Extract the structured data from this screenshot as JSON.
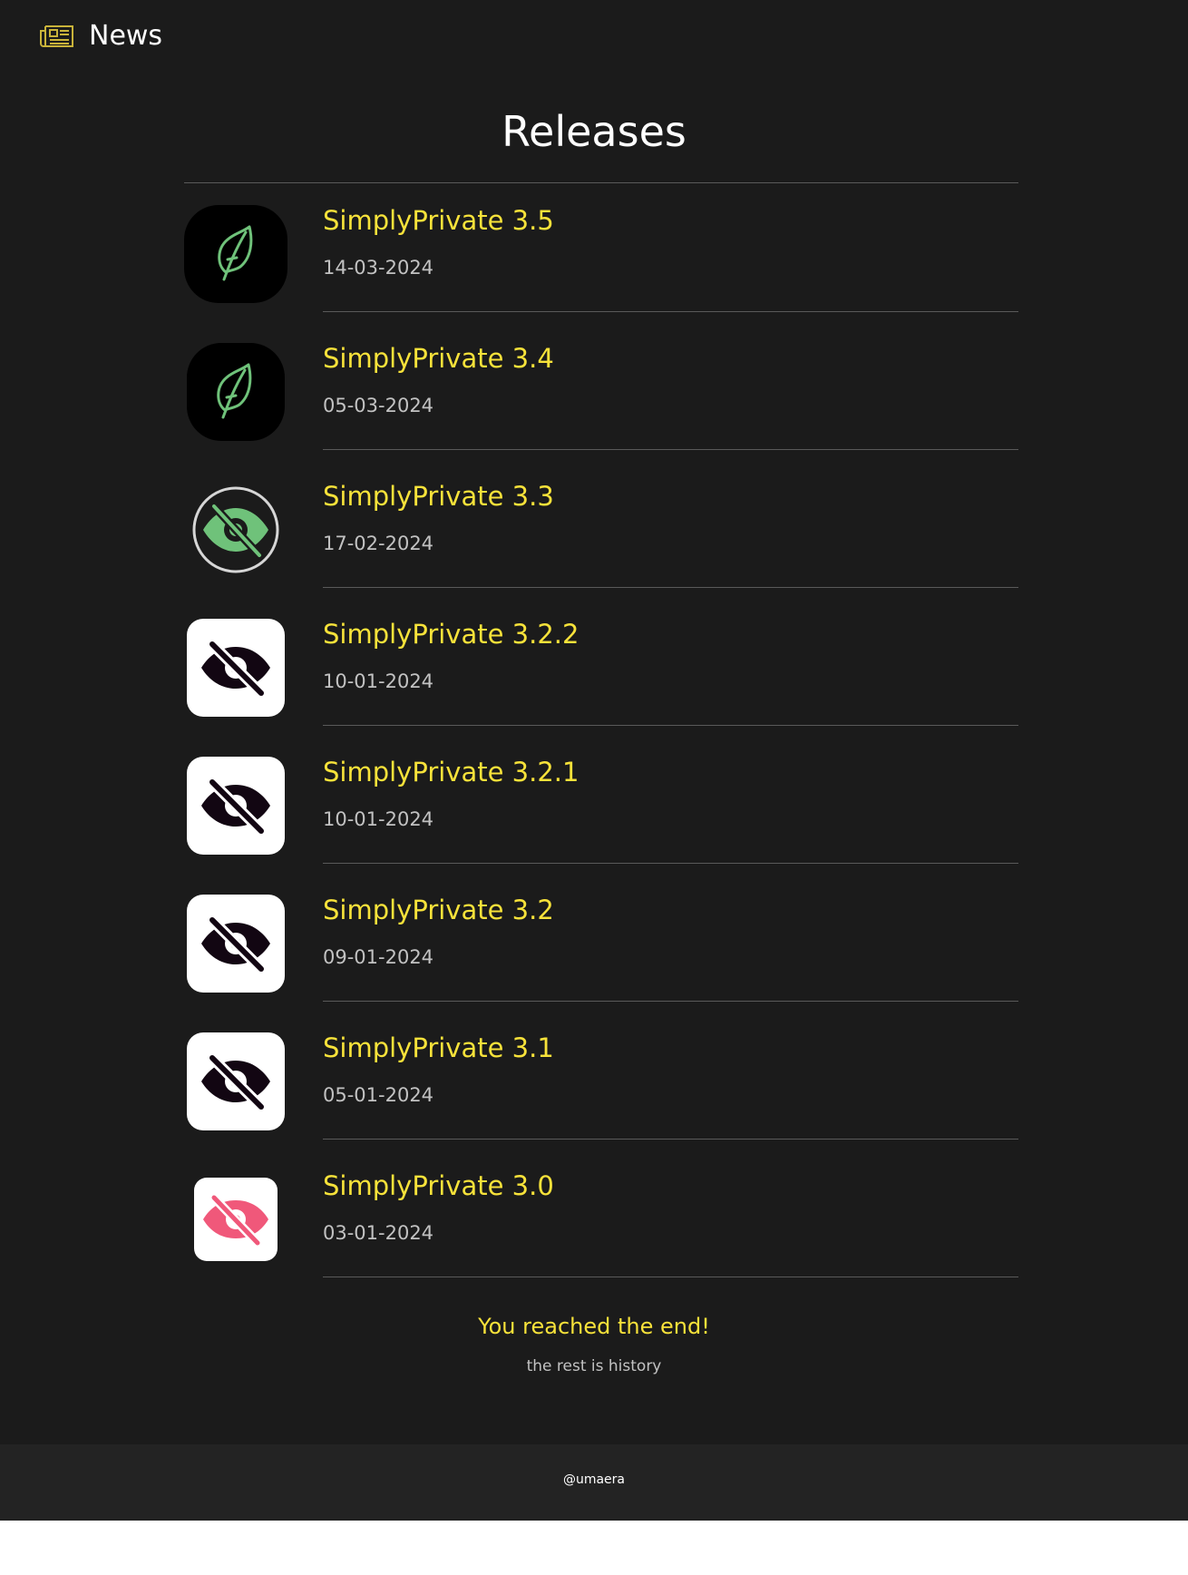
{
  "header": {
    "title": "News",
    "icon": "newspaper-icon",
    "accent": "#c9b33a"
  },
  "main": {
    "heading": "Releases",
    "releases": [
      {
        "title": "SimplyPrivate 3.5",
        "date": "14-03-2024",
        "icon": "leaf-app-icon"
      },
      {
        "title": "SimplyPrivate 3.4",
        "date": "05-03-2024",
        "icon": "leaf-app-icon"
      },
      {
        "title": "SimplyPrivate 3.3",
        "date": "17-02-2024",
        "icon": "green-eye-slash-icon"
      },
      {
        "title": "SimplyPrivate 3.2.2",
        "date": "10-01-2024",
        "icon": "black-eye-slash-icon"
      },
      {
        "title": "SimplyPrivate 3.2.1",
        "date": "10-01-2024",
        "icon": "black-eye-slash-icon"
      },
      {
        "title": "SimplyPrivate 3.2",
        "date": "09-01-2024",
        "icon": "black-eye-slash-icon"
      },
      {
        "title": "SimplyPrivate 3.1",
        "date": "05-01-2024",
        "icon": "black-eye-slash-icon"
      },
      {
        "title": "SimplyPrivate 3.0",
        "date": "03-01-2024",
        "icon": "pink-eye-slash-icon"
      }
    ],
    "end_title": "You reached the end!",
    "end_subtitle": "the rest is history"
  },
  "footer": {
    "handle": "@umaera"
  },
  "colors": {
    "background": "#1b1b1b",
    "footer_background": "#232323",
    "title_yellow": "#f7e23a",
    "date_gray": "#c2c2c2",
    "leaf_green": "#6fc27a",
    "eye_pink": "#f0587a"
  }
}
